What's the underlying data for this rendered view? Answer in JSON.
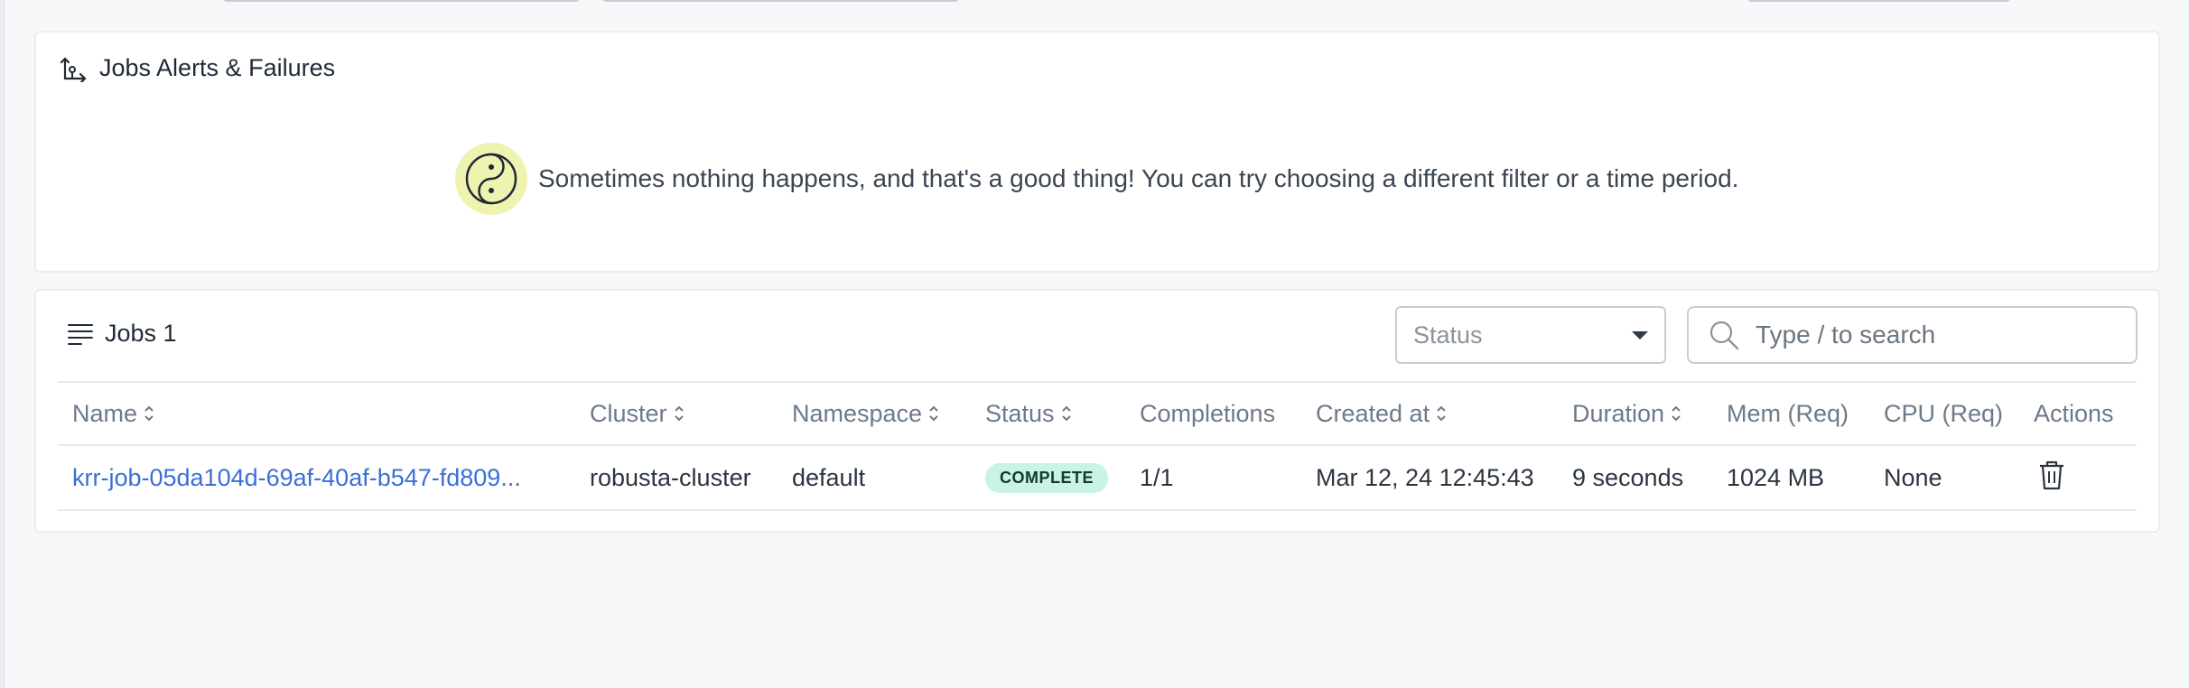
{
  "alerts_card": {
    "title": "Jobs Alerts & Failures",
    "title_icon": "jobs-alert-icon",
    "empty_icon": "yin-yang-icon",
    "empty_message": "Sometimes nothing happens, and that's a good thing! You can try choosing a different filter or a time period."
  },
  "jobs_card": {
    "title": "Jobs 1",
    "title_icon": "list-icon",
    "status_filter": {
      "placeholder": "Status"
    },
    "search": {
      "placeholder": "Type / to search"
    },
    "columns": [
      "Name",
      "Cluster",
      "Namespace",
      "Status",
      "Completions",
      "Created at",
      "Duration",
      "Mem (Req)",
      "CPU (Req)",
      "Actions"
    ],
    "rows": [
      {
        "name": "krr-job-05da104d-69af-40af-b547-fd809...",
        "cluster": "robusta-cluster",
        "namespace": "default",
        "status": "COMPLETE",
        "completions": "1/1",
        "created_at": "Mar 12, 24 12:45:43",
        "duration": "9 seconds",
        "mem_req": "1024 MB",
        "cpu_req": "None",
        "action_icon": "trash-icon"
      }
    ]
  },
  "colors": {
    "link": "#3a6fd8",
    "badge_bg": "#c9f3e3",
    "empty_badge_bg": "#eef3b0"
  }
}
